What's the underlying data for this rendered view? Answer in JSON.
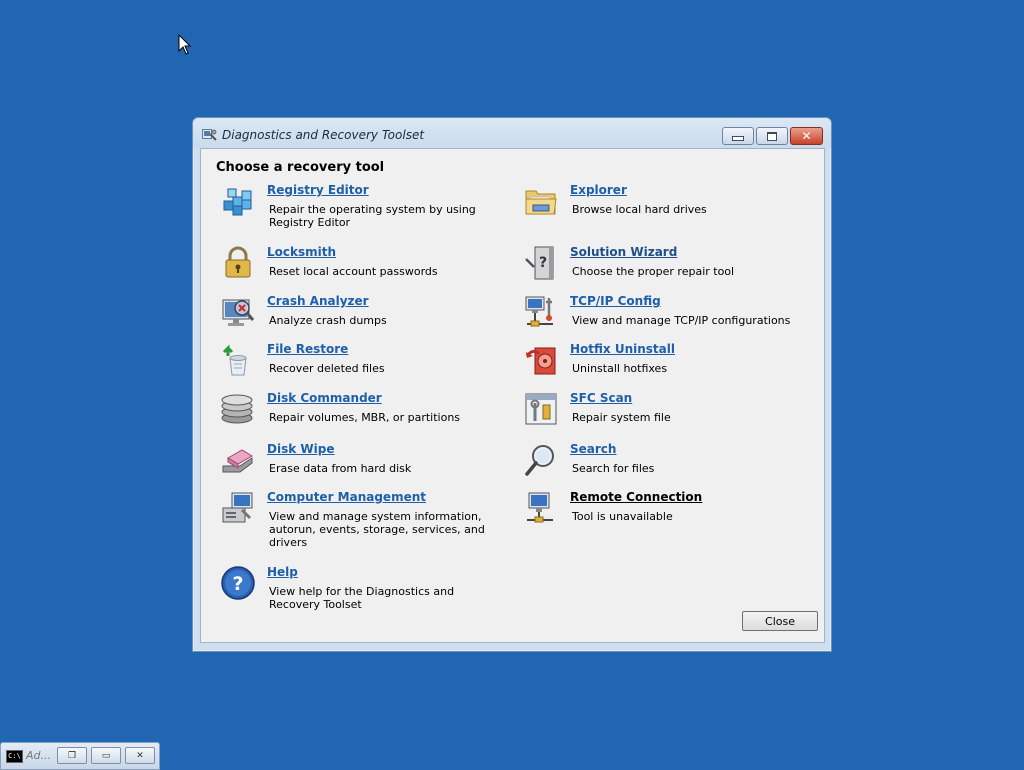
{
  "window": {
    "title": "Diagnostics and Recovery Toolset",
    "heading": "Choose a recovery tool",
    "close_button": "Close"
  },
  "tools_left": [
    {
      "label": "Registry Editor",
      "desc": "Repair the operating system by using Registry Editor",
      "icon": "registry-icon"
    },
    {
      "label": "Locksmith",
      "desc": "Reset local account passwords",
      "icon": "padlock-icon"
    },
    {
      "label": "Crash Analyzer",
      "desc": "Analyze crash dumps",
      "icon": "crash-monitor-icon"
    },
    {
      "label": "File Restore",
      "desc": "Recover deleted files",
      "icon": "recycle-bin-icon"
    },
    {
      "label": "Disk Commander",
      "desc": "Repair volumes, MBR, or partitions",
      "icon": "disk-stack-icon"
    },
    {
      "label": "Disk Wipe",
      "desc": "Erase data from hard disk",
      "icon": "eraser-icon"
    },
    {
      "label": "Computer Management",
      "desc": "View and manage system information, autorun, events, storage, services, and drivers",
      "icon": "computer-management-icon"
    },
    {
      "label": "Help",
      "desc": "View help for the Diagnostics and Recovery Toolset",
      "icon": "help-icon"
    }
  ],
  "tools_right": [
    {
      "label": "Explorer",
      "desc": "Browse local hard drives",
      "icon": "folder-icon"
    },
    {
      "label": "Solution Wizard",
      "desc": "Choose the proper repair tool",
      "icon": "wizard-tower-icon"
    },
    {
      "label": "TCP/IP Config",
      "desc": "View and manage TCP/IP configurations",
      "icon": "network-config-icon"
    },
    {
      "label": "Hotfix Uninstall",
      "desc": "Uninstall hotfixes",
      "icon": "hotfix-icon"
    },
    {
      "label": "SFC Scan",
      "desc": "Repair system file",
      "icon": "sfc-scan-icon"
    },
    {
      "label": "Search",
      "desc": "Search for files",
      "icon": "magnifier-icon"
    },
    {
      "label": "Remote Connection",
      "desc": "Tool is unavailable",
      "icon": "remote-computer-icon"
    }
  ],
  "taskbar": {
    "label": "Ad...",
    "icon": "command-prompt-icon"
  },
  "colors": {
    "desktop": "#2166b3",
    "link": "#1e5fa8"
  }
}
